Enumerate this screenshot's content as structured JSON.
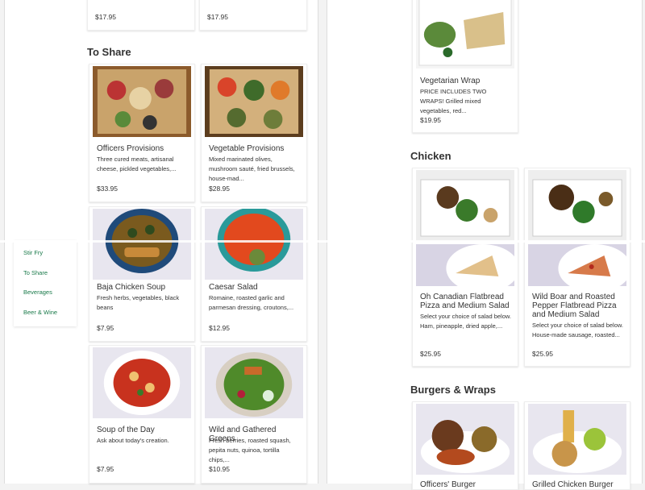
{
  "top_prices": [
    "$17.95",
    "$17.95"
  ],
  "sections": {
    "to_share": "To Share",
    "chicken": "Chicken",
    "burgers": "Burgers & Wraps"
  },
  "items": {
    "officers_provisions": {
      "name": "Officers Provisions",
      "desc": "Three cured meats, artisanal cheese, pickled vegetables,...",
      "price": "$33.95"
    },
    "vegetable_provisions": {
      "name": "Vegetable Provisions",
      "desc": "Mixed marinated olives, mushroom sauté, fried brussels, house-mad...",
      "price": "$28.95"
    },
    "baja_soup": {
      "name": "Baja Chicken Soup",
      "desc": "Fresh herbs, vegetables, black beans",
      "price": "$7.95"
    },
    "caesar": {
      "name": "Caesar Salad",
      "desc": "Romaine, roasted garlic and parmesan dressing, croutons,...",
      "price": "$12.95"
    },
    "soup_day": {
      "name": "Soup of the Day",
      "desc": "Ask about today's creation.",
      "price": "$7.95"
    },
    "greens": {
      "name": "Wild and Gathered Greens",
      "desc": "Fresh berries, roasted squash, pepita nuts, quinoa, tortilla chips,...",
      "price": "$10.95"
    },
    "veg_wrap": {
      "name": "Vegetarian Wrap",
      "desc": "PRICE INCLUDES TWO WRAPS! Grilled mixed vegetables, red...",
      "price": "$19.95"
    },
    "oh_canadian": {
      "name": "Oh Canadian Flatbread Pizza and Medium Salad",
      "desc": "Select your choice of salad below. Ham, pineapple, dried apple,...",
      "price": "$25.95"
    },
    "wild_boar": {
      "name": "Wild Boar and Roasted Pepper Flatbread Pizza and Medium Salad",
      "desc": "Select your choice of salad below. House-made sausage, roasted...",
      "price": "$25.95"
    },
    "officers_burger": {
      "name": "Officers' Burger"
    },
    "grilled_chicken_burger": {
      "name": "Grilled Chicken Burger"
    }
  },
  "sidenav": [
    "Stir Fry",
    "To Share",
    "Beverages",
    "Beer & Wine"
  ],
  "colors": {
    "accent": "#1a7a4a"
  }
}
